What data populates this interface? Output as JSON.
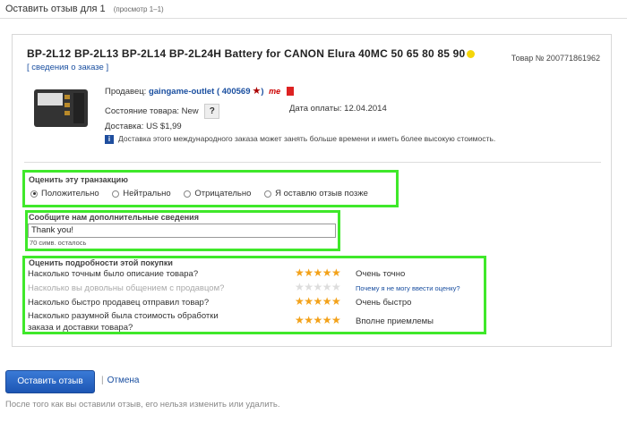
{
  "header": {
    "title": "Оставить отзыв для 1",
    "subtitle": "(просмотр 1–1)"
  },
  "item": {
    "title": "BP-2L12 BP-2L13 BP-2L14 BP-2L24H Battery for CANON Elura 40MC 50 65 80 85 90",
    "item_no": "Товар № 200771861962",
    "details_link": "[ сведения о заказе ]",
    "seller_label": "Продавец:",
    "seller": "gaingame-outlet ( 400569",
    "me_badge": "me",
    "condition_label": "Состояние товара: New",
    "condition_help": "?",
    "pay_date": "Дата оплаты: 12.04.2014",
    "shipping": "Доставка: US $1,99",
    "info_icon": "i",
    "note": "Доставка этого международного заказа может занять больше времени и иметь более высокую стоимость."
  },
  "rating": {
    "title": "Оценить эту транзакцию",
    "options": [
      "Положительно",
      "Нейтрально",
      "Отрицательно",
      "Я оставлю отзыв позже"
    ],
    "selected_index": 0
  },
  "comment": {
    "title": "Сообщите нам дополнительные сведения",
    "value": "Thank you!",
    "remaining": "70 симв. осталось"
  },
  "details": {
    "title": "Оценить подробности этой покупки",
    "rows": [
      {
        "question": "Насколько точным было описание товара?",
        "stars": 5,
        "label": "Очень точно"
      },
      {
        "question": "Насколько вы довольны общением с продавцом?",
        "stars": 0,
        "label": "Почему я не могу ввести оценку?"
      },
      {
        "question": "Насколько быстро продавец отправил товар?",
        "stars": 5,
        "label": "Очень быстро"
      },
      {
        "question": "Насколько разумной была стоимость обработки",
        "question2": "заказа и доставки товара?",
        "stars": 5,
        "label": "Вполне приемлемы"
      }
    ]
  },
  "actions": {
    "submit": "Оставить отзыв",
    "cancel": "Отмена",
    "separator": "|"
  },
  "footer": "После того как вы оставили отзыв, его нельзя изменить или удалить.",
  "colors": {
    "highlight": "#3fe82a",
    "link": "#1a4fa0",
    "star": "#f3a21a",
    "button": "#1d56b4"
  }
}
